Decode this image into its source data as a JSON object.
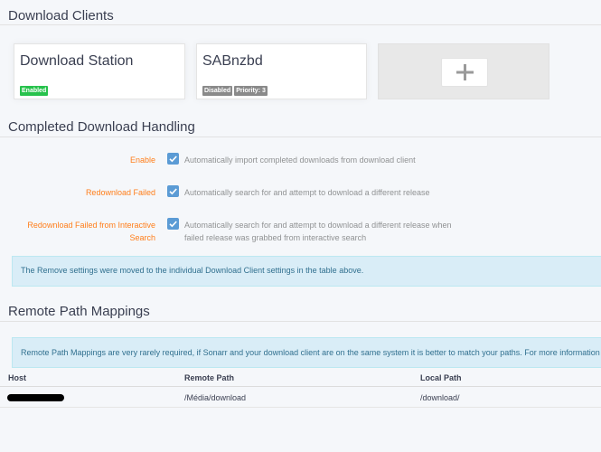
{
  "download_clients": {
    "title": "Download Clients",
    "cards": [
      {
        "name": "Download Station",
        "labels": [
          "Enabled"
        ]
      },
      {
        "name": "SABnzbd",
        "labels": [
          "Disabled",
          "Priority: 3"
        ]
      }
    ],
    "add_icon": "plus-icon"
  },
  "completed_handling": {
    "title": "Completed Download Handling",
    "fields": [
      {
        "label": "Enable",
        "checked": true,
        "help": "Automatically import completed downloads from download client"
      },
      {
        "label": "Redownload Failed",
        "checked": true,
        "help": "Automatically search for and attempt to download a different release"
      },
      {
        "label": "Redownload Failed from Interactive Search",
        "checked": true,
        "help": "Automatically search for and attempt to download a different release when failed release was grabbed from interactive search"
      }
    ],
    "info": "The Remove settings were moved to the individual Download Client settings in the table above."
  },
  "remote_path_mappings": {
    "title": "Remote Path Mappings",
    "info": "Remote Path Mappings are very rarely required, if Sonarr and your download client are on the same system it is better to match your paths. For more information",
    "columns": [
      "Host",
      "Remote Path",
      "Local Path"
    ],
    "rows": [
      {
        "host": "",
        "remote_path": "/Média/download",
        "local_path": "/download/"
      }
    ]
  },
  "colors": {
    "accent_orange": "#ff7e1a",
    "checkbox_blue": "#5b9bd5",
    "success": "#27c24c",
    "info_bg": "#d9edf7"
  }
}
